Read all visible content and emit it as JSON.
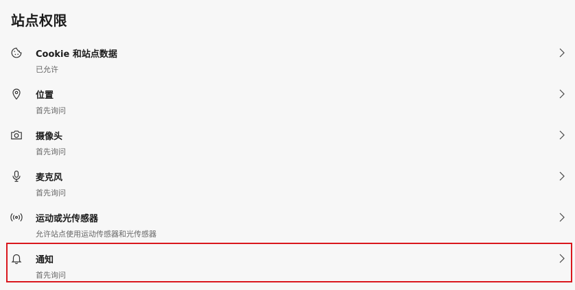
{
  "page": {
    "title": "站点权限"
  },
  "permissions": [
    {
      "title": "Cookie 和站点数据",
      "subtitle": "已允许",
      "icon": "cookie-icon"
    },
    {
      "title": "位置",
      "subtitle": "首先询问",
      "icon": "location-icon"
    },
    {
      "title": "摄像头",
      "subtitle": "首先询问",
      "icon": "camera-icon"
    },
    {
      "title": "麦克风",
      "subtitle": "首先询问",
      "icon": "microphone-icon"
    },
    {
      "title": "运动或光传感器",
      "subtitle": "允许站点使用运动传感器和光传感器",
      "icon": "sensor-icon"
    },
    {
      "title": "通知",
      "subtitle": "首先询问",
      "icon": "bell-icon",
      "highlighted": true
    }
  ],
  "colors": {
    "highlight_border": "#d9161c",
    "background": "#f7f7f7",
    "secondary_text": "#666666"
  }
}
